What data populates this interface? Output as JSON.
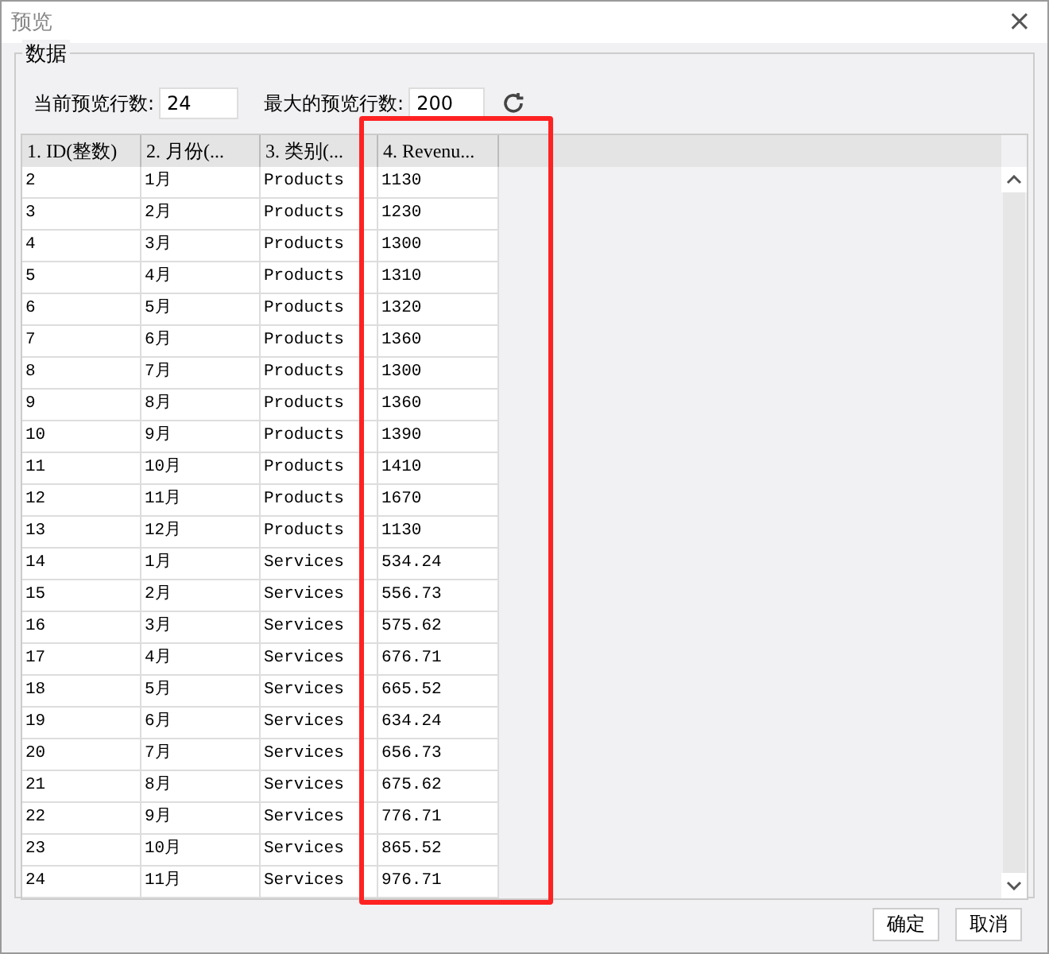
{
  "window": {
    "title": "预览",
    "close": "×"
  },
  "group": {
    "title": "数据"
  },
  "controls": [
    {
      "label": "当前预览行数:",
      "value": "24"
    },
    {
      "label": "最大的预览行数:",
      "value": "200"
    }
  ],
  "table": {
    "columns": [
      {
        "label": "1. ID(整数)",
        "highlighted": false
      },
      {
        "label": "2. 月份(...",
        "highlighted": false
      },
      {
        "label": "3. 类别(...",
        "highlighted": false
      },
      {
        "label": "4. Revenu...",
        "highlighted": true
      }
    ],
    "rows": [
      [
        "2",
        "1月",
        "Products",
        "1130"
      ],
      [
        "3",
        "2月",
        "Products",
        "1230"
      ],
      [
        "4",
        "3月",
        "Products",
        "1300"
      ],
      [
        "5",
        "4月",
        "Products",
        "1310"
      ],
      [
        "6",
        "5月",
        "Products",
        "1320"
      ],
      [
        "7",
        "6月",
        "Products",
        "1360"
      ],
      [
        "8",
        "7月",
        "Products",
        "1300"
      ],
      [
        "9",
        "8月",
        "Products",
        "1360"
      ],
      [
        "10",
        "9月",
        "Products",
        "1390"
      ],
      [
        "11",
        "10月",
        "Products",
        "1410"
      ],
      [
        "12",
        "11月",
        "Products",
        "1670"
      ],
      [
        "13",
        "12月",
        "Products",
        "1130"
      ],
      [
        "14",
        "1月",
        "Services",
        "534.24"
      ],
      [
        "15",
        "2月",
        "Services",
        "556.73"
      ],
      [
        "16",
        "3月",
        "Services",
        "575.62"
      ],
      [
        "17",
        "4月",
        "Services",
        "676.71"
      ],
      [
        "18",
        "5月",
        "Services",
        "665.52"
      ],
      [
        "19",
        "6月",
        "Services",
        "634.24"
      ],
      [
        "20",
        "7月",
        "Services",
        "656.73"
      ],
      [
        "21",
        "8月",
        "Services",
        "675.62"
      ],
      [
        "22",
        "9月",
        "Services",
        "776.71"
      ],
      [
        "23",
        "10月",
        "Services",
        "865.52"
      ],
      [
        "24",
        "11月",
        "Services",
        "976.71"
      ]
    ]
  },
  "buttons": [
    "确定",
    "取消"
  ]
}
